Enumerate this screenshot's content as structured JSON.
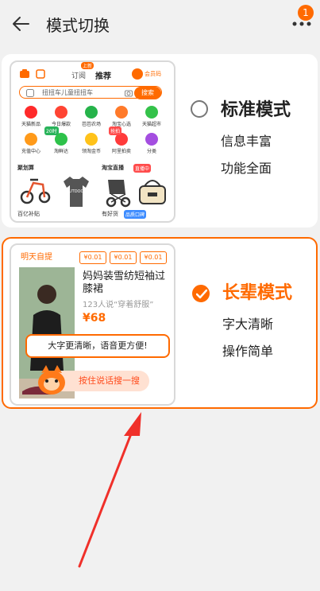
{
  "header": {
    "title": "模式切换",
    "badge_count": "1"
  },
  "standard_mode": {
    "title": "标准模式",
    "lines": [
      "信息丰富",
      "功能全面"
    ],
    "selected": false,
    "preview": {
      "tabs": [
        "订阅",
        "推荐"
      ],
      "tab_badge": "上新",
      "member_code": "会员码",
      "search_placeholder": "扭扭车儿童扭扭车",
      "search_button": "搜索",
      "grid_labels": [
        "天猫新品",
        "今日爆款",
        "芭芭农场",
        "淘宝心选",
        "天猫超市",
        "充值中心",
        "淘鲜达",
        "领淘金币",
        "阿里拍卖",
        "分类"
      ],
      "grid_badge": "20时",
      "auction_tag": "抢拍",
      "feature_left": "聚划算",
      "feature_right": "淘宝直播",
      "feature_live_tag": "直播中",
      "footer_left": "百亿补贴",
      "footer_right": "有好货",
      "footer_tag": "品质口碑",
      "shirt_text": "OUTDOOR"
    }
  },
  "elder_mode": {
    "title": "长辈模式",
    "lines": [
      "字大清晰",
      "操作简单"
    ],
    "selected": true,
    "preview": {
      "tomorrow_pickup": "明天自提",
      "chip_prices": [
        "¥0.01",
        "¥0.01",
        "¥0.01"
      ],
      "product_title": "妈妈装雪纺短袖过膝裙",
      "product_sub": "123人说“穿着舒服”",
      "product_price": "¥68",
      "bubble_text": "大字更清晰，语音更方便!",
      "voice_button": "按住说话搜一搜"
    }
  },
  "colors": {
    "accent": "#ff6a00",
    "background": "#f1f1f1",
    "annotation_arrow": "#f0302a"
  }
}
